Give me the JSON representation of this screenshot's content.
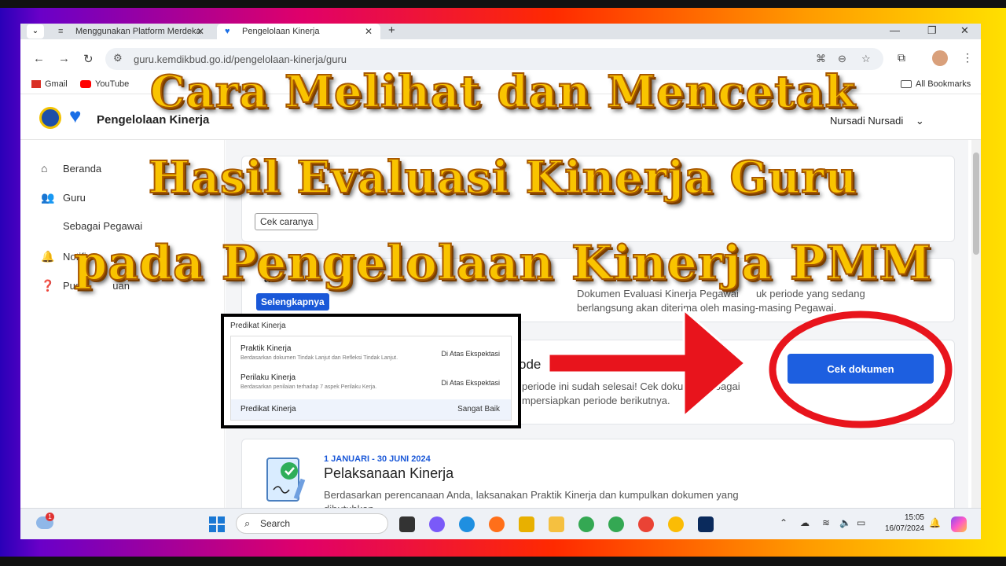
{
  "browser": {
    "tabs": [
      {
        "label": "Menggunakan Platform Merdeka"
      },
      {
        "label": "Pengelolaan Kinerja"
      }
    ],
    "url": "guru.kemdikbud.go.id/pengelolaan-kinerja/guru",
    "bookmarks": [
      "Gmail",
      "YouTube"
    ],
    "all_bookmarks": "All Bookmarks"
  },
  "app": {
    "title": "Pengelolaan Kinerja",
    "user": "Nursadi Nursadi"
  },
  "sidebar": {
    "items": [
      {
        "label": "Beranda"
      },
      {
        "label": "Guru"
      },
      {
        "label": "Sebagai Pegawai"
      },
      {
        "label": "Notifi"
      },
      {
        "label": "Pusat"
      }
    ],
    "pusat_suffix": "uan"
  },
  "main": {
    "card1_button": "Cek caranya",
    "card2_prefix": "as",
    "card2_button": "Selengkapnya",
    "card2_text_line1": "Dokumen Evaluasi Kinerja Pegawai",
    "card2_text_line1b": "uk periode yang sedang",
    "card2_text_line2": "berlangsung akan diterima oleh masing-masing Pegawai.",
    "card3_title_fragment": "ode",
    "card3_line1a": "periode ini sudah selesai! Cek dokum",
    "card3_line1b": "sebagai",
    "card3_line2": "mpersiapkan periode berikutnya.",
    "primary_button": "Cek dokumen",
    "card4_date": "1 JANUARI - 30 JUNI 2024",
    "card4_title": "Pelaksanaan Kinerja",
    "card4_line1": "Berdasarkan perencanaan Anda, laksanakan Praktik Kinerja dan kumpulkan dokumen yang",
    "card4_line2": "dibutuhkan."
  },
  "popup": {
    "title": "Predikat Kinerja",
    "rows": [
      {
        "name": "Praktik Kinerja",
        "desc": "Berdasarkan dokumen Tindak Lanjut dan Refleksi Tindak Lanjut.",
        "value": "Di Atas Ekspektasi"
      },
      {
        "name": "Perilaku Kinerja",
        "desc": "Berdasarkan penilaian terhadap 7 aspek Perilaku Kerja.",
        "value": "Di Atas Ekspektasi"
      }
    ],
    "footer_name": "Predikat Kinerja",
    "footer_value": "Sangat Baik"
  },
  "headline": {
    "line1": "Cara Melihat dan Mencetak",
    "line2": "Hasil Evaluasi Kinerja Guru",
    "line3": "pada Pengelolaan Kinerja PMM"
  },
  "taskbar": {
    "search": "Search",
    "time": "15:05",
    "date": "16/07/2024",
    "weather_badge": "1"
  },
  "colors": {
    "primary": "#1d5fe0",
    "headline": "#f9c400",
    "arrow": "#e8141c"
  }
}
